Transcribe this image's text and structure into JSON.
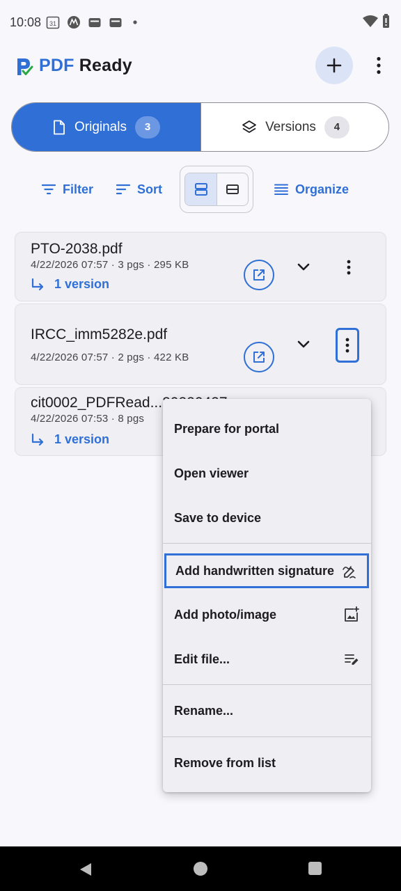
{
  "status_bar": {
    "time": "10:08",
    "calendar_day": "31",
    "icons": [
      "calendar-icon",
      "motorola-icon",
      "wallet-icon",
      "wallet-icon",
      "dot-icon",
      "wifi-icon",
      "battery-icon"
    ]
  },
  "header": {
    "brand_part1": "PDF",
    "brand_part2": "Ready",
    "add_button_icon": "plus-icon",
    "menu_icon": "more-vert-icon"
  },
  "tabs": {
    "originals_label": "Originals",
    "originals_count": "3",
    "versions_label": "Versions",
    "versions_count": "4"
  },
  "toolbar": {
    "filter_label": "Filter",
    "sort_label": "Sort",
    "organize_label": "Organize"
  },
  "files": [
    {
      "name": "PTO-2038.pdf",
      "meta": "4/22/2026 07:57 · 3 pgs · 295 KB",
      "versions": "1 version"
    },
    {
      "name": "IRCC_imm5282e.pdf",
      "meta": "4/22/2026 07:57 · 2 pgs · 422 KB",
      "versions": ""
    },
    {
      "name": "cit0002_PDFRead...20220427...",
      "meta": "4/22/2026 07:53 · 8 pgs",
      "versions": "1 version"
    }
  ],
  "menu": {
    "items": [
      {
        "label": "Prepare for portal"
      },
      {
        "label": "Open viewer"
      },
      {
        "label": "Save to device"
      },
      {
        "label": "Add handwritten signature",
        "icon": "signature-icon"
      },
      {
        "label": "Add photo/image",
        "icon": "add-photo-icon"
      },
      {
        "label": "Edit file...",
        "icon": "edit-note-icon"
      },
      {
        "label": "Rename..."
      },
      {
        "label": "Remove from list"
      }
    ]
  },
  "colors": {
    "accent": "#2f6fd6",
    "accent_soft": "#dbe4f6",
    "card_bg": "#efeff4"
  }
}
